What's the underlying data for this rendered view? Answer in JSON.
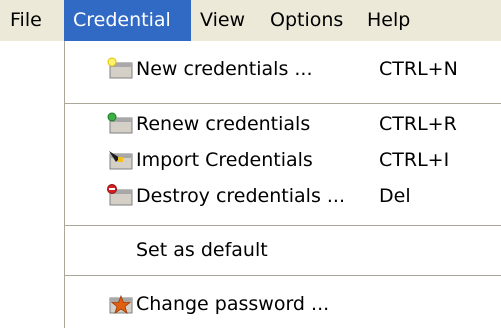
{
  "menubar": {
    "items": [
      {
        "label": "File"
      },
      {
        "label": "Credential"
      },
      {
        "label": "View"
      },
      {
        "label": "Options"
      },
      {
        "label": "Help"
      }
    ]
  },
  "menu": {
    "items": [
      {
        "label": "New credentials ...",
        "shortcut": "CTRL+N",
        "icon": "new-credentials-icon"
      },
      {
        "label": "Renew credentials",
        "shortcut": "CTRL+R",
        "icon": "renew-credentials-icon"
      },
      {
        "label": "Import Credentials",
        "shortcut": "CTRL+I",
        "icon": "import-credentials-icon"
      },
      {
        "label": "Destroy credentials ...",
        "shortcut": "Del",
        "icon": "destroy-credentials-icon"
      },
      {
        "label": "Set as default"
      },
      {
        "label": "Change password ...",
        "icon": "change-password-icon"
      }
    ]
  },
  "colors": {
    "menubar_bg": "#ece9d8",
    "highlight": "#316ac5",
    "separator": "#aca899"
  }
}
